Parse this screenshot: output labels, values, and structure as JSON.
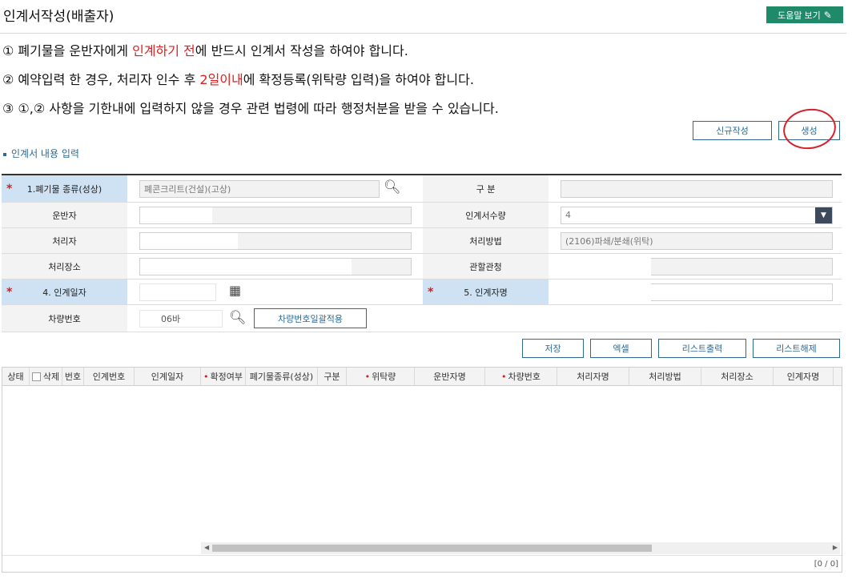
{
  "page": {
    "title": "인계서작성(배출자)",
    "help_label": "도움말 보기"
  },
  "notices": [
    {
      "pre": "① 폐기물을 운반자에게 ",
      "red": "인계하기 전",
      "post": "에 반드시 인계서 작성을 하여야 합니다."
    },
    {
      "pre": "② 예약입력 한 경우, 처리자 인수 후 ",
      "red": "2일이내",
      "post": "에 확정등록(위탁량 입력)을 하여야 합니다."
    },
    {
      "pre": "③ ①,② 사항을 기한내에 입력하지 않을 경우 관련 법령에 따라 행정처분을 받을 수 있습니다.",
      "red": "",
      "post": ""
    }
  ],
  "top_buttons": {
    "new": "신규작성",
    "create": "생성"
  },
  "section_label": "인계서 내용 입력",
  "form": {
    "waste_type_label": "1.폐기물 종류(성상)",
    "waste_type_value": "폐콘크리트(건설)(고상)",
    "division_label": "구 분",
    "carrier_label": "운반자",
    "copies_label": "인계서수량",
    "copies_value": "4",
    "processor_label": "처리자",
    "method_label": "처리방법",
    "method_value": "(2106)파쇄/분쇄(위탁)",
    "site_label": "처리장소",
    "authority_label": "관할관청",
    "date_label": "4. 인계일자",
    "handover_name_label": "5. 인계자명",
    "vehicle_label": "차량번호",
    "vehicle_value": "06바",
    "vehicle_batch_button": "차량번호일괄적용"
  },
  "list_buttons": {
    "save": "저장",
    "excel": "엑셀",
    "print": "리스트출력",
    "clear": "리스트해제"
  },
  "grid": {
    "columns": [
      "상태",
      "삭제",
      "번호",
      "인계번호",
      "인계일자",
      "확정여부",
      "폐기물종류(성상)",
      "구분",
      "위탁량",
      "운반자명",
      "차량번호",
      "처리자명",
      "처리방법",
      "처리장소",
      "인계자명"
    ],
    "pager": "[0 / 0]"
  },
  "colors": {
    "accent": "#2e6a93",
    "help_bg": "#1f8a6a",
    "required_bg": "#cfe2f3",
    "notice_red": "#e02020"
  }
}
